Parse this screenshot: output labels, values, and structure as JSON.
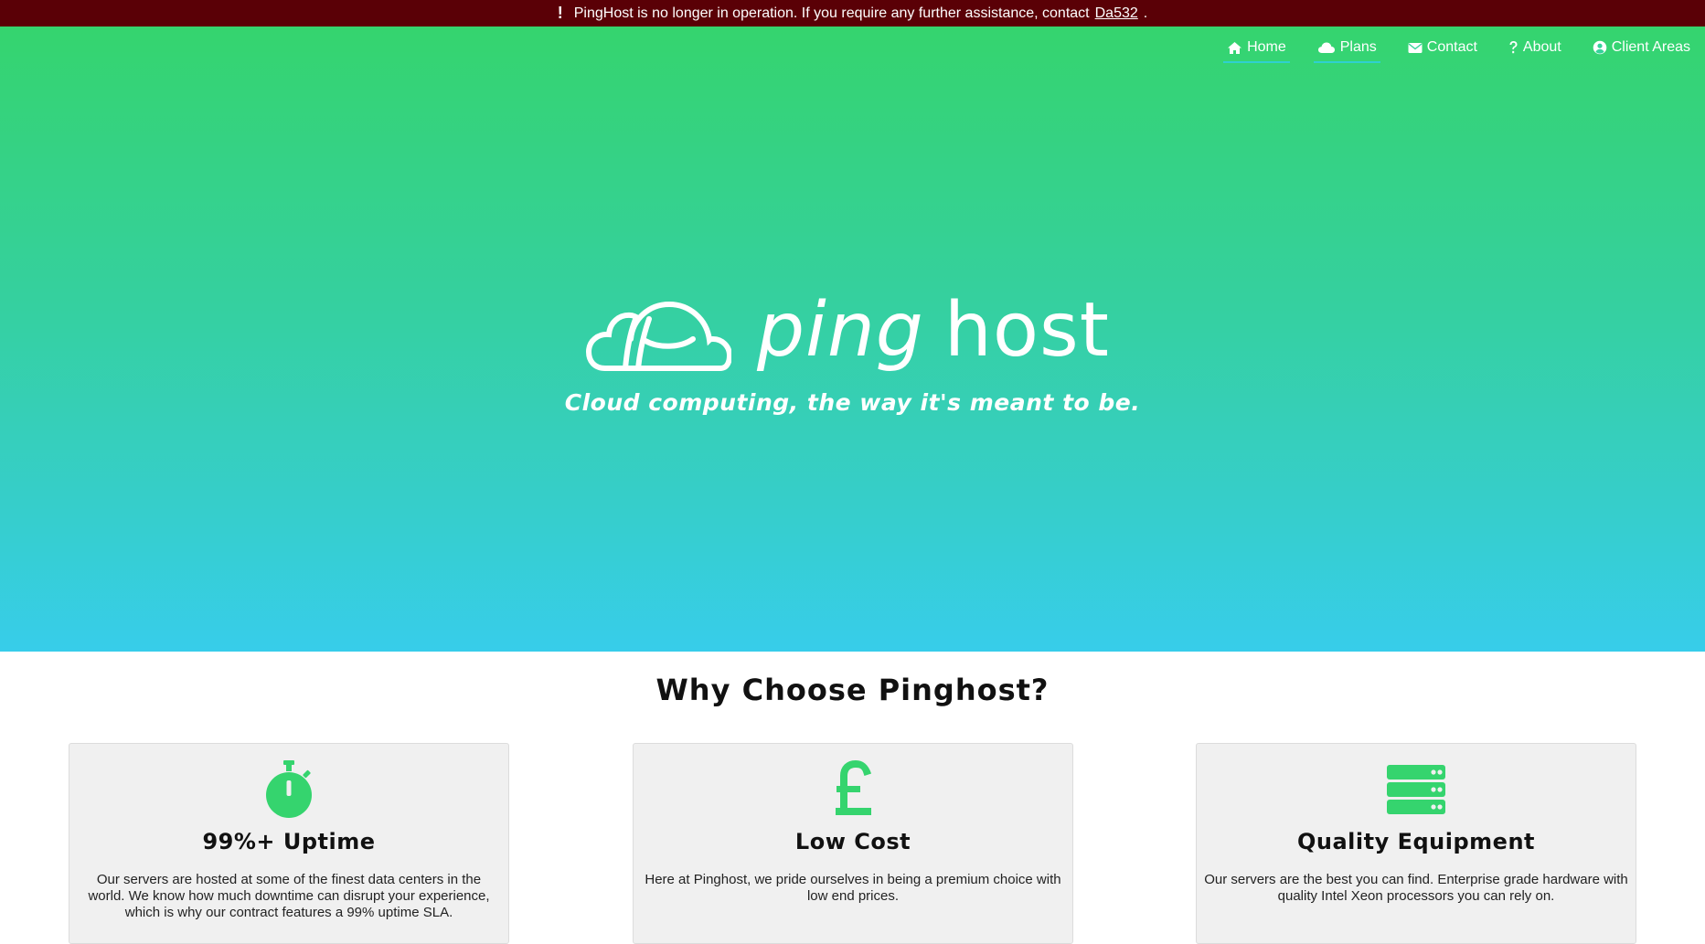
{
  "notice": {
    "text": "PingHost is no longer in operation. If you require any further assistance, contact",
    "link_text": "Da532",
    "suffix": ".",
    "bg_color": "#5a0006"
  },
  "nav": {
    "items": [
      {
        "label": "Home",
        "icon": "home-icon",
        "active": true
      },
      {
        "label": "Plans",
        "icon": "cloud-icon",
        "active": true
      },
      {
        "label": "Contact",
        "icon": "envelope-icon",
        "active": false
      },
      {
        "label": "About",
        "icon": "question-icon",
        "active": false
      },
      {
        "label": "Client Areas",
        "icon": "user-circle-icon",
        "active": false
      }
    ]
  },
  "hero": {
    "logo_ping": "ping",
    "logo_host": "host",
    "tagline": "Cloud computing, the way it's meant to be.",
    "gradient_top": "#35d46e",
    "gradient_bottom": "#37cdea"
  },
  "why": {
    "title": "Why Choose Pinghost?",
    "accent_color": "#35d46e",
    "cards": [
      {
        "icon": "stopwatch-icon",
        "title": "99%+ Uptime",
        "text": "Our servers are hosted at some of the finest data centers in the world. We know how much downtime can disrupt your experience, which is why our contract features a 99% uptime SLA."
      },
      {
        "icon": "pound-icon",
        "title": "Low Cost",
        "text": "Here at Pinghost, we pride ourselves in being a premium choice with low end prices."
      },
      {
        "icon": "server-icon",
        "title": "Quality Equipment",
        "text": "Our servers are the best you can find. Enterprise grade hardware with quality Intel Xeon processors you can rely on."
      }
    ]
  }
}
